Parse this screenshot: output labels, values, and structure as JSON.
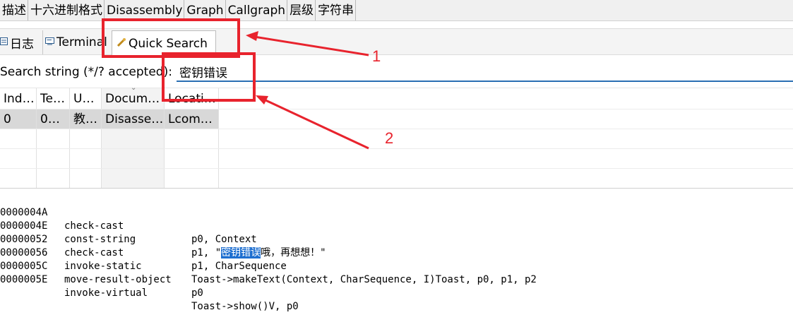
{
  "top_tabs": [
    "描述",
    "十六进制格式",
    "Disassembly",
    "Graph",
    "Callgraph",
    "层级",
    "字符串"
  ],
  "view_tabs": {
    "log": "日志",
    "terminal": "Terminal",
    "quick_search": "Quick Search"
  },
  "search": {
    "label": "Search string (*/? accepted):",
    "value": "密钥错误"
  },
  "table": {
    "headers": [
      "Ind…",
      "Te…",
      "U…",
      "Docum…",
      "Locati…"
    ],
    "rows": [
      [
        "0",
        "0…",
        "教…",
        "Disasse…",
        "Lcom…"
      ]
    ]
  },
  "disassembly": [
    {
      "addr": "0000004A",
      "op": "check-cast",
      "args": "p0, Context"
    },
    {
      "addr": "0000004E",
      "op": "const-string",
      "args_pre": "p1, \"",
      "args_hl": "密钥错误",
      "args_post": "哦，再想想！\""
    },
    {
      "addr": "00000052",
      "op": "check-cast",
      "args": "p1, CharSequence"
    },
    {
      "addr": "00000056",
      "op": "invoke-static",
      "args": "Toast->makeText(Context, CharSequence, I)Toast, p0, p1, p2"
    },
    {
      "addr": "0000005C",
      "op": "move-result-object",
      "args": "p0"
    },
    {
      "addr": "0000005E",
      "op": "invoke-virtual",
      "args": "Toast->show()V, p0"
    }
  ],
  "annotations": {
    "label1": "1",
    "label2": "2",
    "color": "#e8232d"
  },
  "icons": {
    "log": "console-icon",
    "terminal": "terminal-icon",
    "quick_search": "wand-icon"
  }
}
